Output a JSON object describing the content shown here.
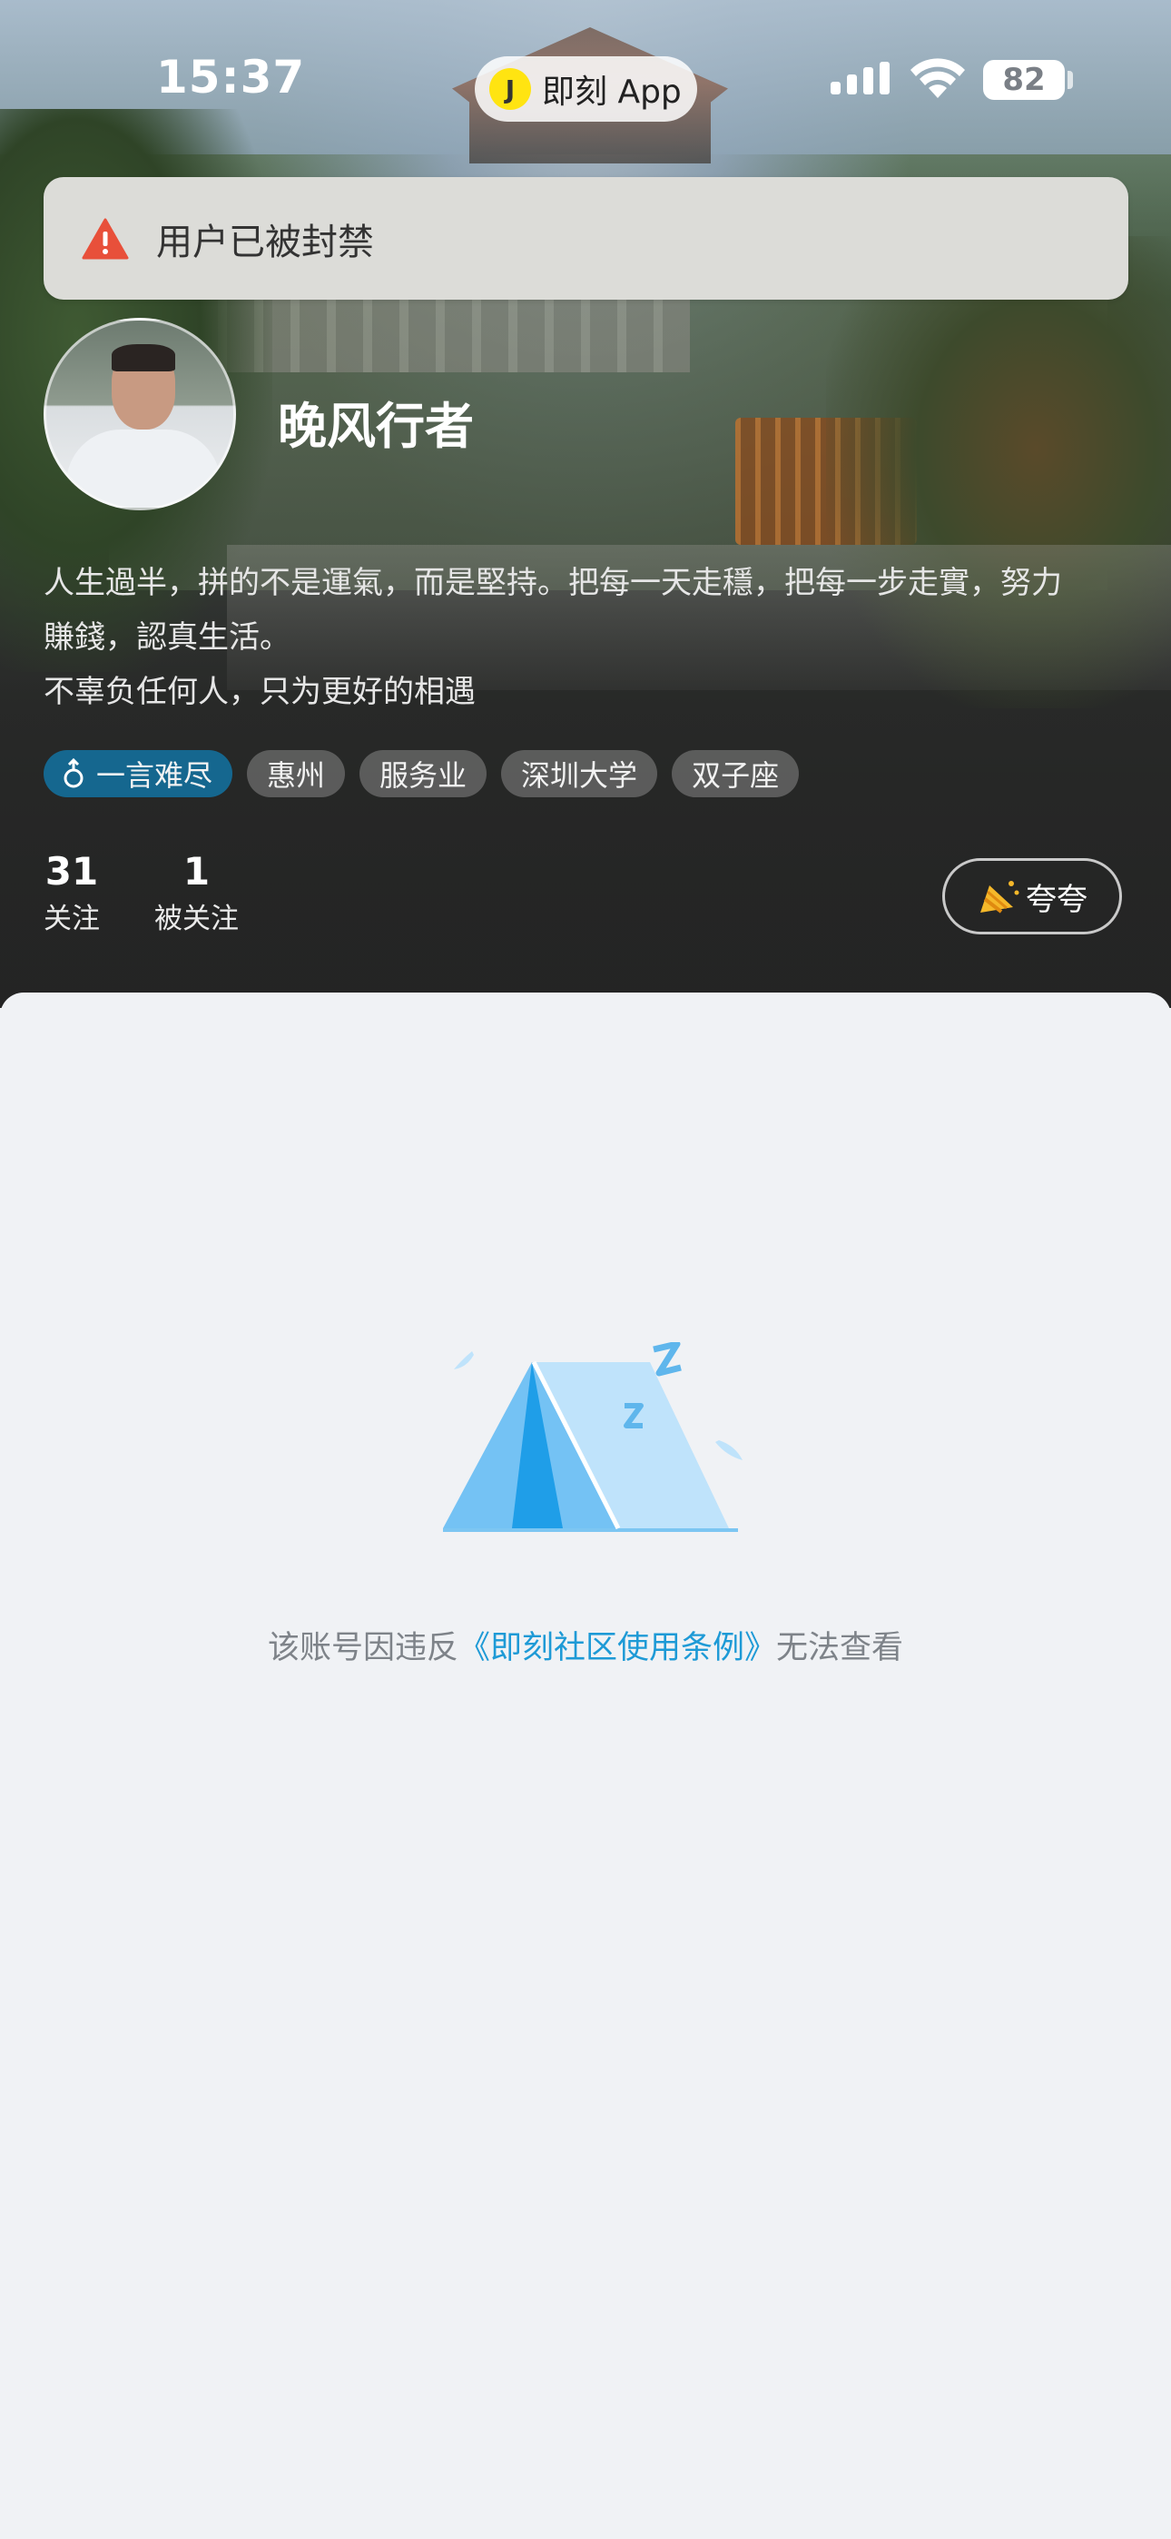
{
  "status_bar": {
    "time": "15:37",
    "app_pill_name": "即刻 App",
    "app_logo_glyph": "J",
    "battery": "82"
  },
  "banner": {
    "text": "用户已被封禁",
    "icon": "warning-triangle-icon",
    "icon_color": "#e8503a"
  },
  "profile": {
    "nickname": "晚风行者",
    "bio_lines": [
      "人生過半，拼的不是運氣，而是堅持。把每一天走穩，把每一步走實，努力",
      "賺錢，認真生活。",
      "不辜负任何人，只为更好的相遇"
    ],
    "tags": {
      "primary": "一言难尽",
      "list": [
        "惠州",
        "服务业",
        "深圳大学",
        "双子座"
      ]
    },
    "stats": {
      "following_count": "31",
      "following_label": "关注",
      "followers_count": "1",
      "followers_label": "被关注"
    },
    "praise_button": "夸夸"
  },
  "content": {
    "notice_prefix": "该账号因违反",
    "notice_link": "《即刻社区使用条例》",
    "notice_suffix": "无法查看",
    "link_color": "#1e9ad6"
  }
}
